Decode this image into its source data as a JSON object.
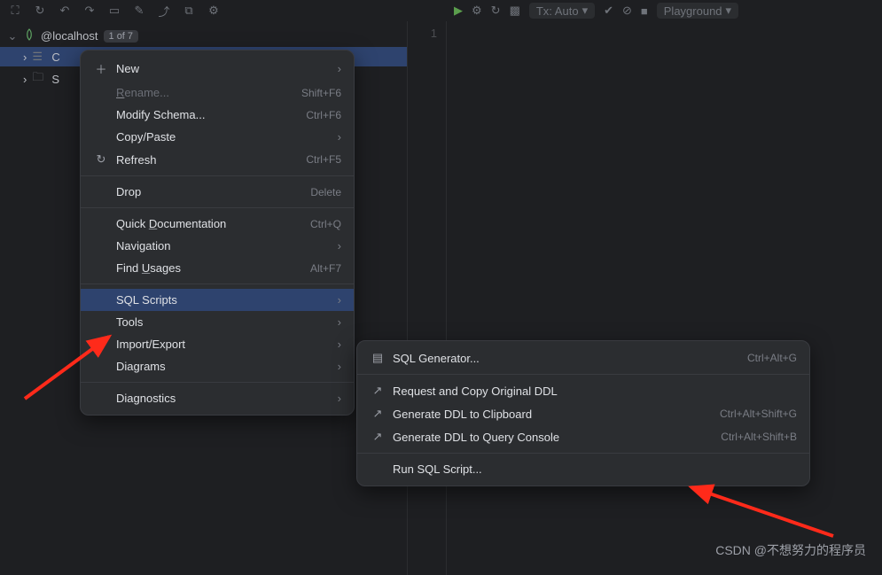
{
  "toolbar_left_icons": [
    "expand-icon",
    "refresh-icon",
    "undo-icon",
    "redo-icon",
    "separator",
    "db-icon",
    "edit-icon",
    "export-icon",
    "query-icon",
    "tools-icon"
  ],
  "connection": {
    "name": "@localhost",
    "counter": "1 of 7"
  },
  "tree": [
    {
      "icon": "schema-icon",
      "label": "C",
      "active": true
    },
    {
      "icon": "folder-icon",
      "label": "S",
      "active": false
    }
  ],
  "editor": {
    "toolbar": {
      "run": "▶",
      "tx_label": "Tx: Auto",
      "stop": "■",
      "session": "Playground"
    },
    "gutter_lines": [
      "1"
    ]
  },
  "context_menu": [
    {
      "icon": "plus-icon",
      "label": "New",
      "submenu": true
    },
    {
      "label": "Rename...",
      "mn": "R",
      "shortcut": "Shift+F6",
      "disabled": true
    },
    {
      "label": "Modify Schema...",
      "shortcut": "Ctrl+F6"
    },
    {
      "label": "Copy/Paste",
      "submenu": true
    },
    {
      "icon": "refresh-icon",
      "label": "Refresh",
      "shortcut": "Ctrl+F5"
    },
    {
      "sep": true
    },
    {
      "label": "Drop",
      "shortcut": "Delete"
    },
    {
      "sep": true
    },
    {
      "label": "Quick Documentation",
      "mn": "D",
      "shortcut": "Ctrl+Q"
    },
    {
      "label": "Navigation",
      "submenu": true
    },
    {
      "label": "Find Usages",
      "mn": "U",
      "shortcut": "Alt+F7"
    },
    {
      "sep": true
    },
    {
      "label": "SQL Scripts",
      "submenu": true,
      "highlight": true
    },
    {
      "label": "Tools",
      "submenu": true
    },
    {
      "label": "Import/Export",
      "submenu": true
    },
    {
      "label": "Diagrams",
      "submenu": true
    },
    {
      "sep": true
    },
    {
      "label": "Diagnostics",
      "submenu": true
    }
  ],
  "sql_scripts_submenu": [
    {
      "icon": "generator-icon",
      "label": "SQL Generator...",
      "shortcut": "Ctrl+Alt+G"
    },
    {
      "sep": true
    },
    {
      "icon": "external-icon",
      "label": "Request and Copy Original DDL"
    },
    {
      "icon": "external-icon",
      "label": "Generate DDL to Clipboard",
      "shortcut": "Ctrl+Alt+Shift+G"
    },
    {
      "icon": "external-icon",
      "label": "Generate DDL to Query Console",
      "shortcut": "Ctrl+Alt+Shift+B"
    },
    {
      "sep": true
    },
    {
      "label": "Run SQL Script..."
    }
  ],
  "watermark": "CSDN @不想努力的程序员",
  "colors": {
    "accent": "#2e436e"
  }
}
